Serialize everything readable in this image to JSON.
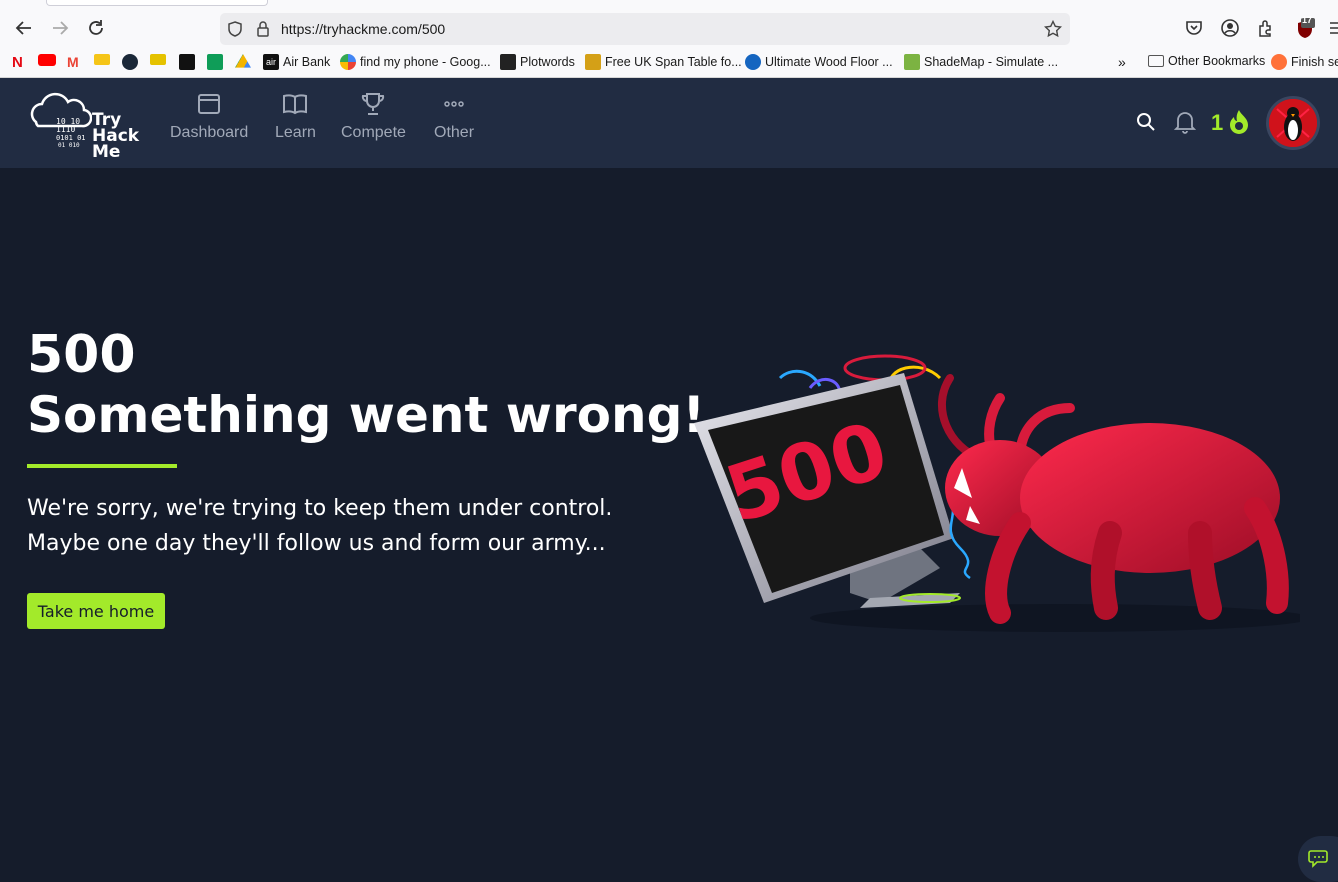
{
  "browser": {
    "url": "https://tryhackme.com/500",
    "badge_count": "17",
    "bookmarks": [
      {
        "label": "",
        "color": "#e50914",
        "glyph": "N"
      },
      {
        "label": "",
        "color": "#ff0000",
        "glyph": "▶"
      },
      {
        "label": "",
        "color": "#ea4335",
        "glyph": "M"
      },
      {
        "label": "",
        "color": "#f5c518",
        "glyph": "IMDb"
      },
      {
        "label": "",
        "color": "#1b2838",
        "glyph": "S"
      },
      {
        "label": "",
        "color": "#000000",
        "glyph": "≡"
      },
      {
        "label": "",
        "color": "#0f9d58",
        "glyph": "+"
      },
      {
        "label": "",
        "color": "#4285f4",
        "glyph": "▲"
      },
      {
        "label": "Air Bank",
        "color": "#111111",
        "glyph": "air"
      },
      {
        "label": "find my phone - Goog...",
        "color": "#4285f4",
        "glyph": "◉"
      },
      {
        "label": "Plotwords",
        "color": "#222222",
        "glyph": "P"
      },
      {
        "label": "Free UK Span Table fo...",
        "color": "#d4a017",
        "glyph": "TBC"
      },
      {
        "label": "Ultimate Wood Floor ...",
        "color": "#1565c0",
        "glyph": "U"
      },
      {
        "label": "ShadeMap - Simulate ...",
        "color": "#7cb342",
        "glyph": "S"
      },
      {
        "label": "Other Bookmarks",
        "color": "#555555",
        "glyph": "▭"
      },
      {
        "label": "Finish se",
        "color": "#ff7139",
        "glyph": "●"
      }
    ]
  },
  "nav": {
    "logo_line1": "Try",
    "logo_line2": "Hack",
    "logo_line3": "Me",
    "items": [
      {
        "label": "Dashboard"
      },
      {
        "label": "Learn"
      },
      {
        "label": "Compete"
      },
      {
        "label": "Other"
      }
    ],
    "streak": "1"
  },
  "main": {
    "code": "500",
    "title": "Something went wrong!",
    "message_line1": "We're sorry, we're trying to keep them under control.",
    "message_line2": "Maybe one day they'll follow us and form our army...",
    "button": "Take me home",
    "illustration_text": "500"
  },
  "colors": {
    "accent": "#a3ea2a",
    "nav_bg": "#212c42",
    "page_bg": "#151c2b",
    "bug_red": "#d81b3c"
  }
}
